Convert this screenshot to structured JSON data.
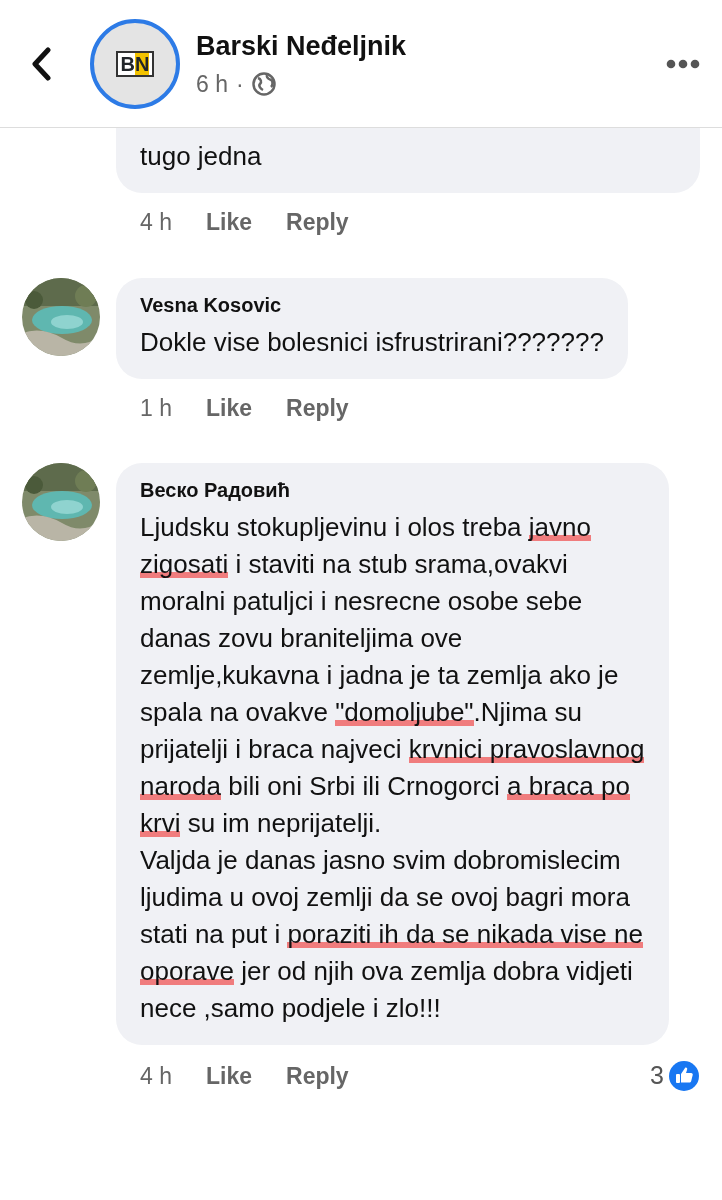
{
  "header": {
    "page_name": "Barski Neđeljnik",
    "time": "6 h",
    "separator": "·",
    "logo_text": "BN"
  },
  "comments": [
    {
      "avatar": false,
      "segments": [
        {
          "text": "tugo jedna",
          "underlined": false
        }
      ],
      "time": "4 h",
      "like": "Like",
      "reply": "Reply"
    },
    {
      "avatar": true,
      "author": "Vesna Kosovic",
      "segments": [
        {
          "text": "Dokle vise bolesnici isfrustrirani???????",
          "underlined": false
        }
      ],
      "time": "1 h",
      "like": "Like",
      "reply": "Reply"
    },
    {
      "avatar": true,
      "author": "Веско Радовић",
      "segments": [
        {
          "text": "Ljudsku stokupljevinu i olos treba ",
          "underlined": false
        },
        {
          "text": "javno zigosati",
          "underlined": true
        },
        {
          "text": " i staviti na stub srama,ovakvi moralni patuljci i nesrecne osobe sebe danas zovu braniteljima ove zemlje,kukavna i jadna je ta zemlja ako je spala na ovakve ",
          "underlined": false
        },
        {
          "text": "\"domoljube\"",
          "underlined": true
        },
        {
          "text": ".Njima su prijatelji i braca najveci ",
          "underlined": false
        },
        {
          "text": "krvnici pravoslavnog naroda",
          "underlined": true
        },
        {
          "text": " bili oni Srbi ili Crnogorci ",
          "underlined": false
        },
        {
          "text": "a braca po krvi",
          "underlined": true
        },
        {
          "text": " su im neprijatelji.\nValjda je danas jasno svim dobromislecim ljudima u ovoj zemlji da se ovoj bagri mora stati na put i ",
          "underlined": false
        },
        {
          "text": "poraziti ih da se nikada vise ne oporave",
          "underlined": true
        },
        {
          "text": " jer od njih ova zemlja dobra vidjeti nece ,samo podjele i zlo!!!",
          "underlined": false
        }
      ],
      "time": "4 h",
      "like": "Like",
      "reply": "Reply",
      "reaction_count": "3"
    }
  ]
}
